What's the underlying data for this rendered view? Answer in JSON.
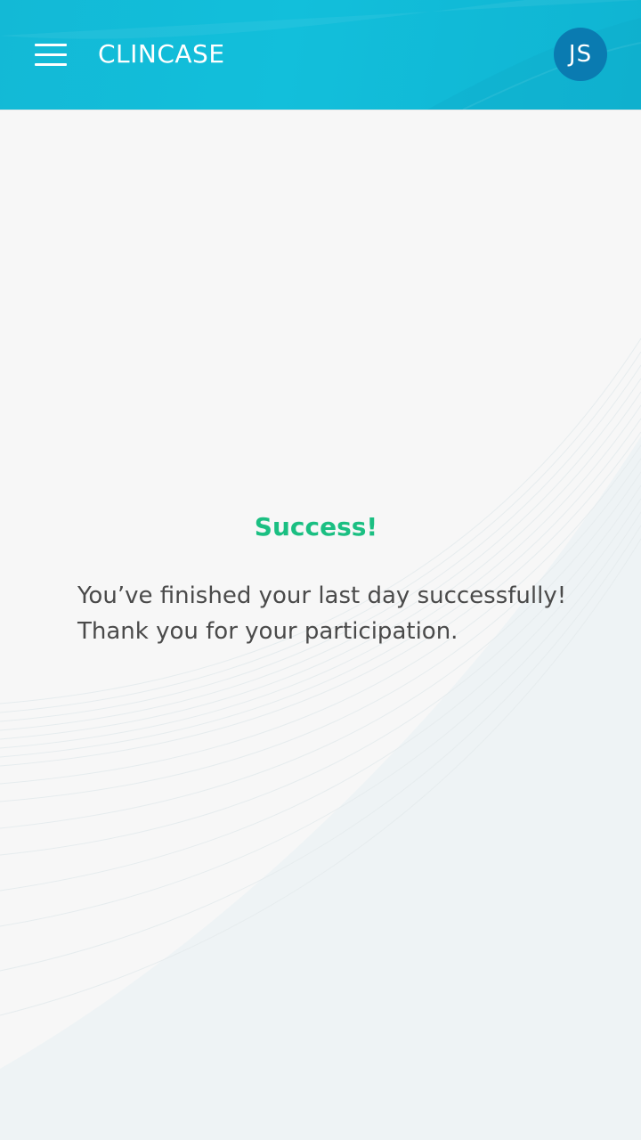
{
  "header": {
    "menu_icon": "hamburger-menu-icon",
    "app_title": "CLINCASE",
    "avatar_initials": "JS"
  },
  "main": {
    "success_title": "Success!",
    "message_line_1": "You’ve finished your last day successfully!",
    "message_line_2": "Thank you for your participation."
  },
  "colors": {
    "header_background": "#12bfdb",
    "avatar_background": "#0a7bb1",
    "success_green": "#1bbf82",
    "body_text": "#4a4a4a",
    "page_background": "#f7f7f7"
  }
}
